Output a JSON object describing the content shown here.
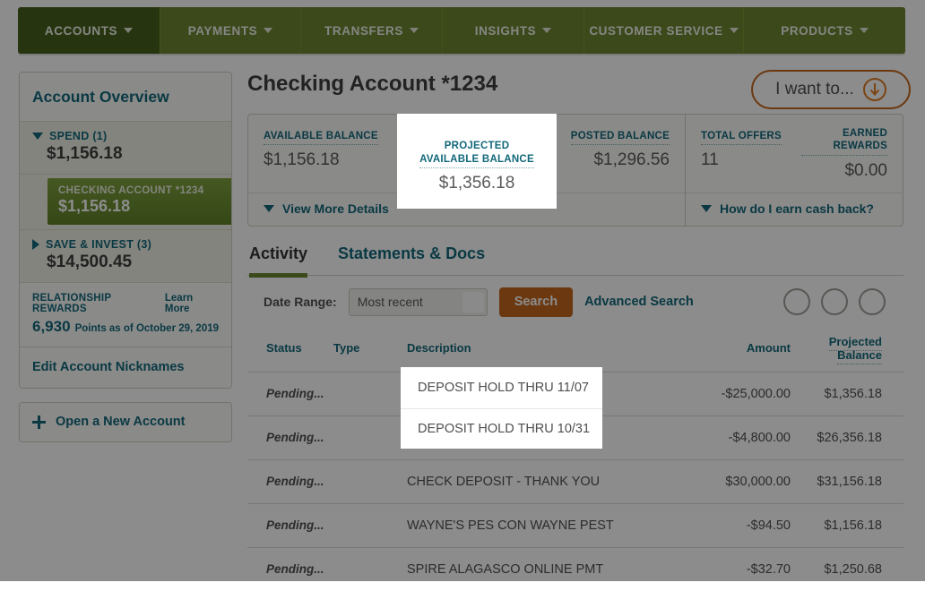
{
  "nav": {
    "items": [
      {
        "label": "ACCOUNTS",
        "active": true
      },
      {
        "label": "PAYMENTS",
        "active": false
      },
      {
        "label": "TRANSFERS",
        "active": false
      },
      {
        "label": "INSIGHTS",
        "active": false
      },
      {
        "label": "CUSTOMER SERVICE",
        "active": false
      },
      {
        "label": "PRODUCTS",
        "active": false
      }
    ],
    "caret_icon": "chevron-down-icon"
  },
  "sidebar": {
    "title": "Account Overview",
    "spend": {
      "label": "SPEND (1)",
      "amount": "$1,156.18",
      "expanded_icon": "triangle-down-icon"
    },
    "selected_account": {
      "name": "CHECKING ACCOUNT *1234",
      "amount": "$1,156.18"
    },
    "save_invest": {
      "label": "SAVE & INVEST (3)",
      "amount": "$14,500.45",
      "collapsed_icon": "triangle-right-icon"
    },
    "rewards": {
      "title": "RELATIONSHIP REWARDS",
      "learn_more": "Learn More",
      "points": "6,930",
      "as_of": "Points as of October 29, 2019"
    },
    "edit_nicknames": "Edit Account Nicknames",
    "open_new_account": {
      "label": "Open a New Account",
      "icon": "plus-icon"
    }
  },
  "header": {
    "page_title": "Checking Account *1234",
    "i_want_to": {
      "label": "I want to...",
      "icon": "circled-arrow-down-icon"
    }
  },
  "balances": {
    "available": {
      "label": "AVAILABLE BALANCE",
      "value": "$1,156.18"
    },
    "projected": {
      "label_line1": "PROJECTED",
      "label_line2": "AVAILABLE BALANCE",
      "value": "$1,356.18"
    },
    "posted": {
      "label": "POSTED BALANCE",
      "value": "$1,296.56"
    },
    "total_offers": {
      "label": "TOTAL OFFERS",
      "value": "11"
    },
    "earned_rewards": {
      "label": "EARNED REWARDS",
      "value": "$0.00"
    },
    "view_more_details": "View More Details",
    "how_earn_cash_back": "How do I earn cash back?"
  },
  "tabs": [
    {
      "label": "Activity",
      "active": true
    },
    {
      "label": "Statements & Docs",
      "active": false
    }
  ],
  "filters": {
    "date_range_label": "Date Range:",
    "date_range_value": "Most recent",
    "search_button": "Search",
    "advanced_search": "Advanced Search",
    "icon_buttons": [
      "circle-button-1",
      "circle-button-2",
      "circle-button-3"
    ]
  },
  "table": {
    "columns": [
      "Status",
      "Type",
      "Description",
      "Amount",
      "Projected Balance"
    ],
    "rows": [
      {
        "status": "Pending...",
        "type": "green-chip",
        "description": "DEPOSIT HOLD THRU 11/07",
        "amount": "-$25,000.00",
        "balance": "$1,356.18"
      },
      {
        "status": "Pending...",
        "type": "green-chip",
        "description": "DEPOSIT HOLD THRU 10/31",
        "amount": "-$4,800.00",
        "balance": "$26,356.18"
      },
      {
        "status": "Pending...",
        "type": "green-chip",
        "description": "CHECK DEPOSIT - THANK YOU",
        "amount": "$30,000.00",
        "balance": "$31,156.18"
      },
      {
        "status": "Pending...",
        "type": "green-chip",
        "description": "WAYNE'S PES CON WAYNE PEST",
        "amount": "-$94.50",
        "balance": "$1,156.18"
      },
      {
        "status": "Pending...",
        "type": "green-chip",
        "description": "SPIRE ALAGASCO  ONLINE PMT",
        "amount": "-$32.70",
        "balance": "$1,250.68"
      }
    ]
  },
  "highlights": {
    "projected_label_line1": "PROJECTED",
    "projected_label_line2": "AVAILABLE BALANCE",
    "projected_value": "$1,356.18",
    "desc_row_1": "DEPOSIT HOLD THRU 11/07",
    "desc_row_2": "DEPOSIT HOLD THRU 10/31"
  },
  "colors": {
    "nav_active": "#44601a",
    "nav_inactive": "#6b8430",
    "teal": "#11687a",
    "orange": "#c2661d",
    "chip_green": "#6b8c1e"
  }
}
